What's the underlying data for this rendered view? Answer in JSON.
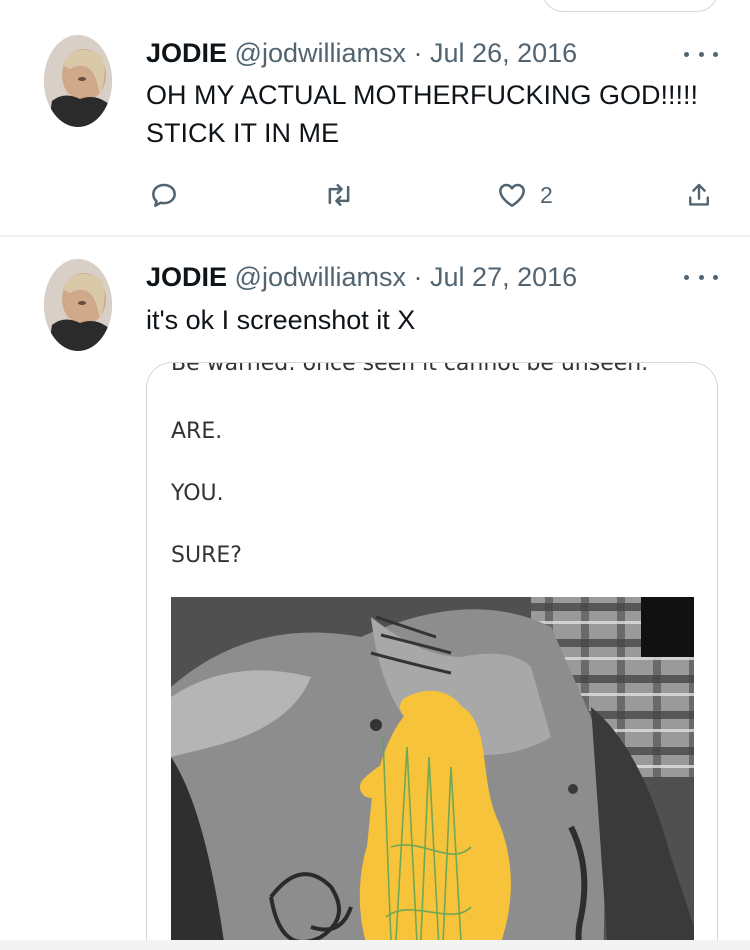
{
  "tweets": [
    {
      "author_name": "JODIE",
      "handle": "@jodwilliamsx",
      "separator": "·",
      "date": "Jul 26, 2016",
      "text_lines": [
        "OH MY ACTUAL MOTHERFUCKING GOD!!!!!",
        "STICK IT IN ME"
      ],
      "actions": {
        "reply_icon": "reply-icon",
        "retweet_icon": "retweet-icon",
        "like_icon": "heart-icon",
        "like_count": "2",
        "share_icon": "share-icon"
      }
    },
    {
      "author_name": "JODIE",
      "handle": "@jodwilliamsx",
      "separator": "·",
      "date": "Jul 27, 2016",
      "text_lines": [
        "it's ok I screenshot it X"
      ],
      "media": {
        "lines": [
          "Be warned: once seen it cannot be unseen.",
          "ARE.",
          "YOU.",
          "SURE?"
        ],
        "photo": "black-and-white shirtless photo partially censored with yellow scribble"
      }
    }
  ],
  "colors": {
    "text_primary": "#0f1419",
    "text_secondary": "#536471",
    "border": "#cfd9de",
    "censor_yellow": "#f6c33a"
  }
}
